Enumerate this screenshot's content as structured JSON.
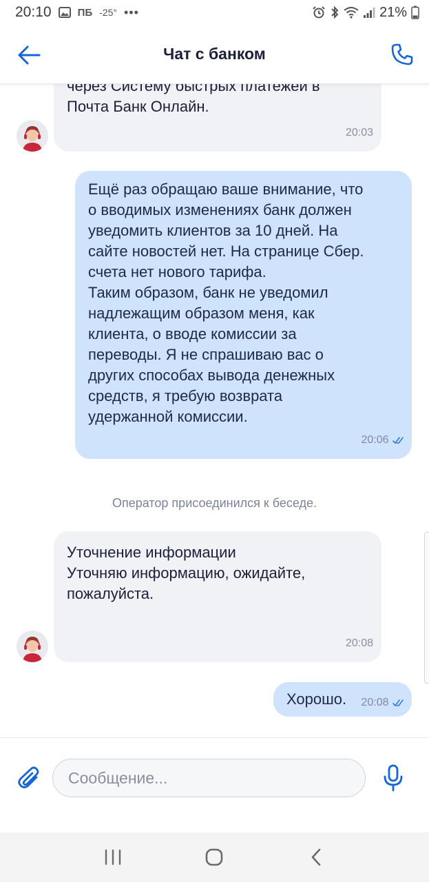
{
  "status_bar": {
    "time": "20:10",
    "carrier_label": "ПБ",
    "temperature": "-25°",
    "more": "•••",
    "battery": "21%"
  },
  "header": {
    "title": "Чат с банком",
    "back_icon": "arrow-left-icon",
    "call_icon": "phone-icon"
  },
  "messages": [
    {
      "direction": "incoming",
      "text": "через Систему быстрых платежей в\nПочта Банк Онлайн.",
      "time": "20:03"
    },
    {
      "direction": "outgoing",
      "text": "Ещё раз обращаю ваше внимание, что\nо вводимых изменениях банк должен\nуведомить клиентов за 10 дней. На\nсайте новостей нет. На странице Сбер.\nсчета нет нового тарифа.\nТаким образом, банк не уведомил\nнадлежащим образом меня, как\nклиента, о вводе комиссии за\nпереводы. Я не спрашиваю вас о\nдругих способах вывода денежных\nсредств, я требую возврата\nудержанной комиссии.",
      "time": "20:06",
      "status": "read"
    },
    {
      "direction": "system",
      "text": "Оператор присоединился к беседе."
    },
    {
      "direction": "incoming",
      "text": "Уточнение информации\nУточняю информацию, ожидайте,\nпожалуйста.",
      "time": "20:08"
    },
    {
      "direction": "outgoing",
      "text": "Хорошо.",
      "time": "20:08",
      "status": "read"
    }
  ],
  "composer": {
    "placeholder": "Сообщение..."
  },
  "colors": {
    "accent": "#1565d8",
    "incoming_bubble": "#f1f2f5",
    "outgoing_bubble": "#cfe3fd",
    "read_check": "#2f7de1"
  }
}
